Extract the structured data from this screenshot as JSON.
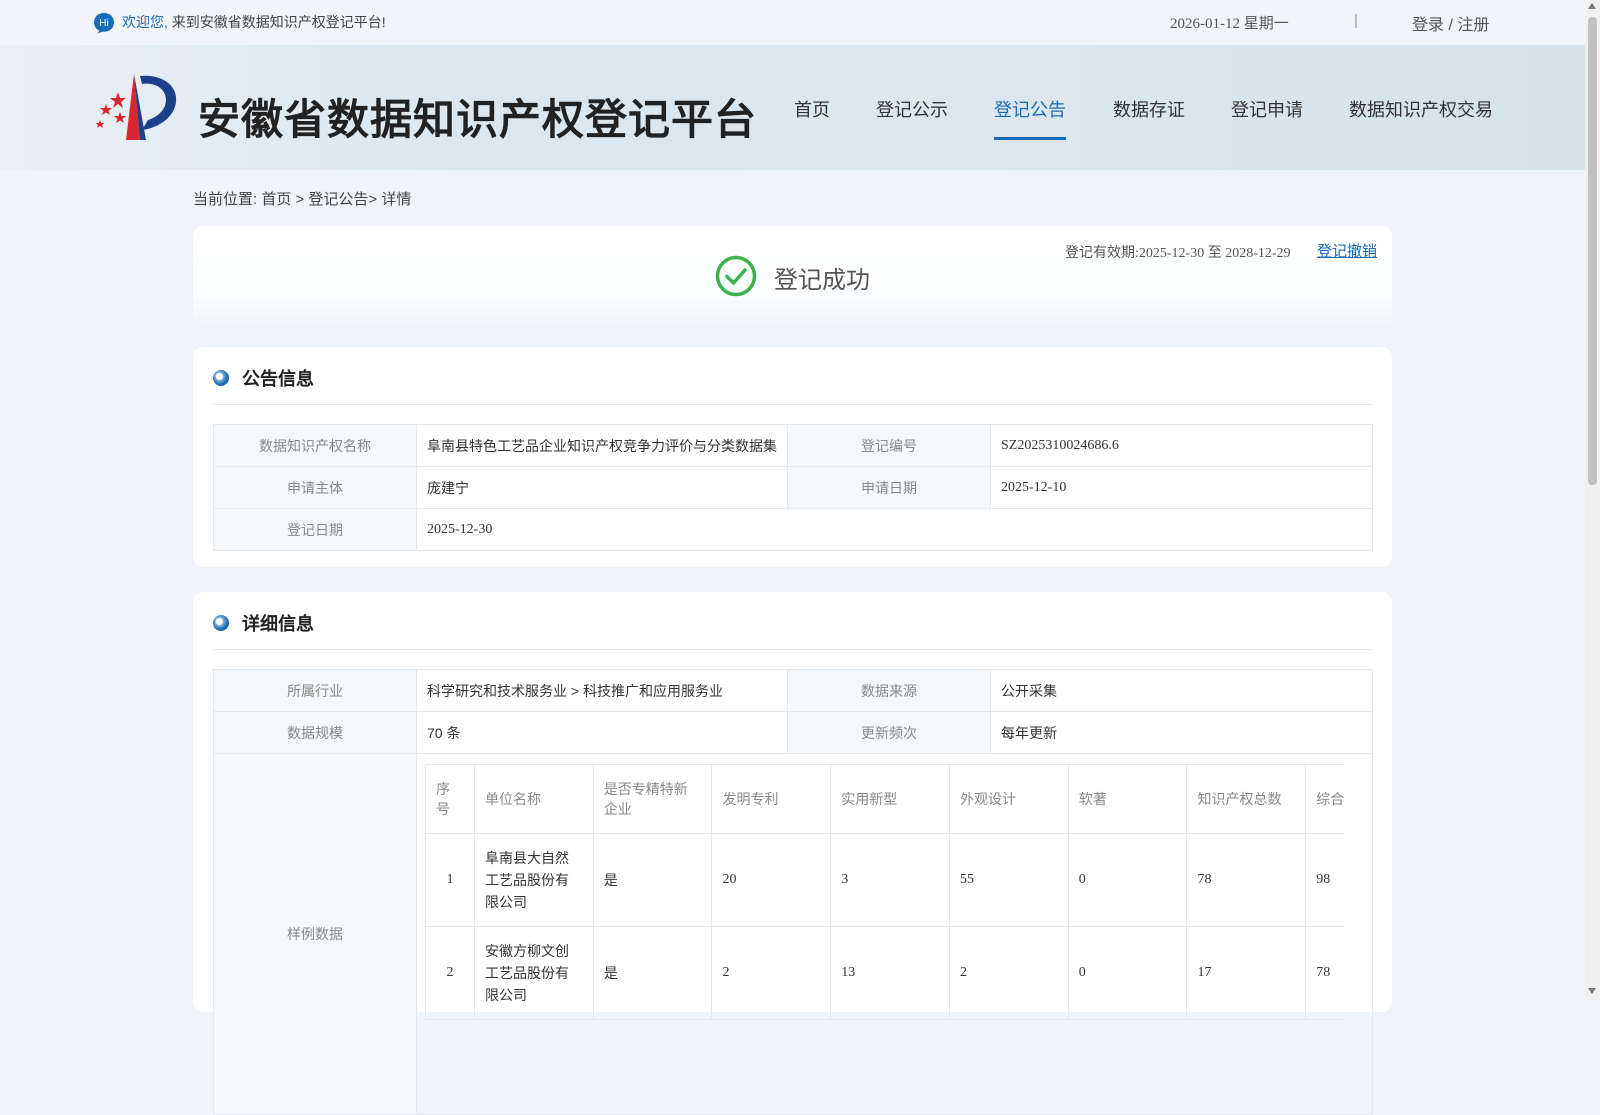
{
  "topbar": {
    "hi": "Hi",
    "welcome_prefix": "欢迎您,",
    "welcome_text": "来到安徽省数据知识产权登记平台!",
    "date": "2026-01-12 星期一",
    "separator": "|",
    "login": "登录 / 注册"
  },
  "header": {
    "site_title": "安徽省数据知识产权登记平台",
    "nav": [
      "首页",
      "登记公示",
      "登记公告",
      "数据存证",
      "登记申请",
      "数据知识产权交易"
    ],
    "active_nav": "登记公告"
  },
  "breadcrumb": "当前位置: 首页 > 登记公告> 详情",
  "status": {
    "text": "登记成功",
    "validity": "登记有效期:2025-12-30 至 2028-12-29",
    "revoke": "登记撤销"
  },
  "announcement": {
    "title": "公告信息",
    "name_label": "数据知识产权名称",
    "name_value": "阜南县特色工艺品企业知识产权竞争力评价与分类数据集",
    "reg_no_label": "登记编号",
    "reg_no_value": "SZ2025310024686.6",
    "applicant_label": "申请主体",
    "applicant_value": "庞建宁",
    "apply_date_label": "申请日期",
    "apply_date_value": "2025-12-10",
    "reg_date_label": "登记日期",
    "reg_date_value": "2025-12-30"
  },
  "detail": {
    "title": "详细信息",
    "industry_label": "所属行业",
    "industry_value": "科学研究和技术服务业 > 科技推广和应用服务业",
    "source_label": "数据来源",
    "source_value": "公开采集",
    "scale_label": "数据规模",
    "scale_value": "70 条",
    "freq_label": "更新频次",
    "freq_value": "每年更新",
    "sample_label": "样例数据",
    "sample_headers": [
      "序号",
      "单位名称",
      "是否专精特新企业",
      "发明专利",
      "实用新型",
      "外观设计",
      "软著",
      "知识产权总数",
      "综合"
    ],
    "sample_rows": [
      [
        "1",
        "阜南县大自然工艺品股份有限公司",
        "是",
        "20",
        "3",
        "55",
        "0",
        "78",
        "98"
      ],
      [
        "2",
        "安徽方柳文创工艺品股份有限公司",
        "是",
        "2",
        "13",
        "2",
        "0",
        "17",
        "78"
      ]
    ]
  },
  "colors": {
    "accent": "#1a6bb5",
    "success": "#3bb34a",
    "background": "#eef4f9"
  }
}
